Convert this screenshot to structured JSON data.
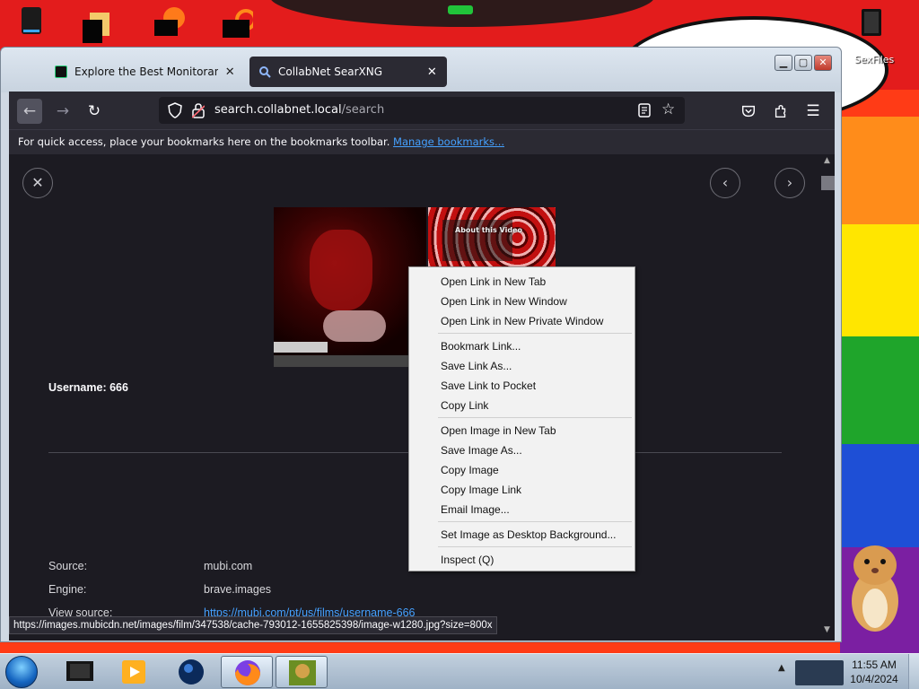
{
  "desktop": {
    "icons": [
      {
        "name": "recycle-bin",
        "label": ""
      },
      {
        "name": "folder",
        "label": ""
      },
      {
        "name": "browser",
        "label": ""
      },
      {
        "name": "app",
        "label": ""
      }
    ],
    "sexfiles_label": "SexFiles"
  },
  "browser": {
    "tabs": [
      {
        "label": "Explore the Best Monitoranimat",
        "active": false
      },
      {
        "label": "CollabNet SearXNG",
        "active": true
      }
    ],
    "url_host": "search.collabnet.local",
    "url_path": "/search",
    "bookmarks_text": "For quick access, place your bookmarks here on the bookmarks toolbar.",
    "bookmarks_link": "Manage bookmarks...",
    "status_url": "https://images.mubicdn.net/images/film/347538/cache-793012-1655825398/image-w1280.jpg?size=800x"
  },
  "page": {
    "thumb_caption": "About this Video",
    "username": "Username: 666",
    "details": [
      {
        "label": "Source:",
        "value": "mubi.com"
      },
      {
        "label": "Engine:",
        "value": "brave.images"
      },
      {
        "label": "View source:",
        "value": "https://mubi.com/pt/us/films/username-666"
      }
    ]
  },
  "context_menu": {
    "groups": [
      [
        "Open Link in New Tab",
        "Open Link in New Window",
        "Open Link in New Private Window"
      ],
      [
        "Bookmark Link...",
        "Save Link As...",
        "Save Link to Pocket",
        "Copy Link"
      ],
      [
        "Open Image in New Tab",
        "Save Image As...",
        "Copy Image",
        "Copy Image Link",
        "Email Image..."
      ],
      [
        "Set Image as Desktop Background..."
      ],
      [
        "Inspect (Q)"
      ]
    ]
  },
  "taskbar": {
    "time": "11:55 AM",
    "date": "10/4/2024"
  },
  "colors": {
    "accent_link": "#45a1ff",
    "browser_bg": "#1c1b22",
    "toolbar_bg": "#2b2a33"
  }
}
